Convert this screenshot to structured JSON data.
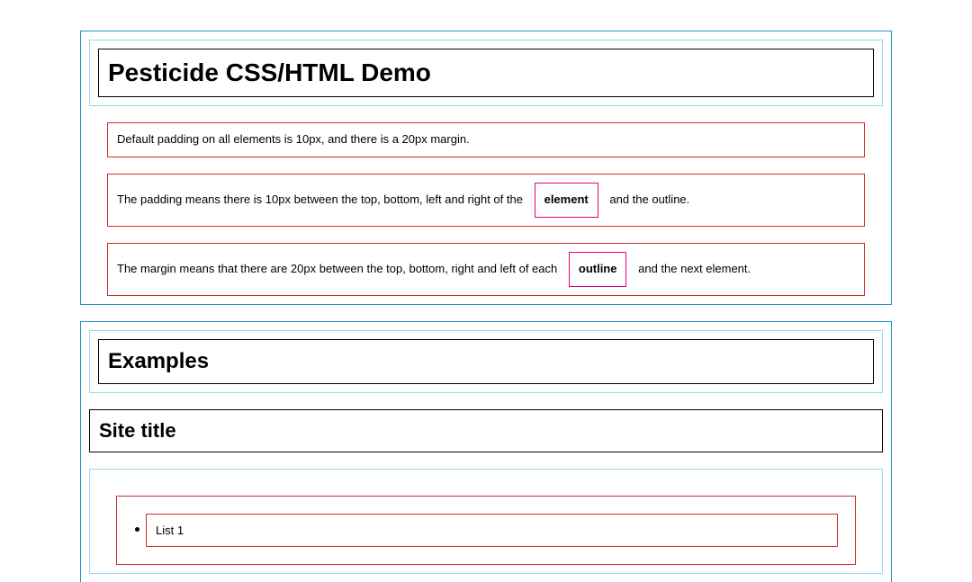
{
  "section1": {
    "title": "Pesticide CSS/HTML Demo",
    "p1": "Default padding on all elements is 10px, and there is a 20px margin.",
    "p2a": "The padding means there is 10px between the top, bottom, left and right of the",
    "p2_strong": "element",
    "p2b": "and the outline.",
    "p3a": "The margin means that there are 20px between the top, bottom, right and left of each",
    "p3_strong": "outline",
    "p3b": "and the next element."
  },
  "section2": {
    "examples_heading": "Examples",
    "site_title": "Site title",
    "list": {
      "item1": "List 1"
    }
  }
}
